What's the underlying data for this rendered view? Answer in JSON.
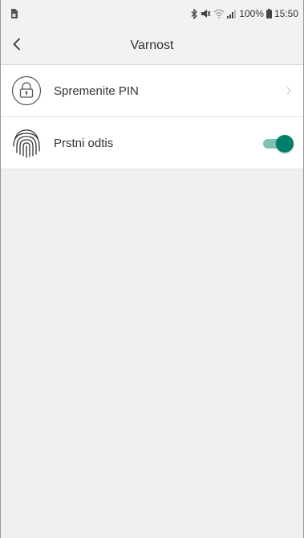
{
  "status_bar": {
    "battery_percent": "100%",
    "time": "15:50",
    "icons": [
      "sim-icon",
      "bluetooth-icon",
      "mute-icon",
      "wifi-icon",
      "signal-icon",
      "battery-icon"
    ]
  },
  "app_bar": {
    "title": "Varnost",
    "back_icon": "back-arrow-icon"
  },
  "settings": [
    {
      "label": "Spremenite PIN",
      "icon": "lock-icon",
      "control": "chevron"
    },
    {
      "label": "Prstni odtis",
      "icon": "fingerprint-icon",
      "control": "toggle",
      "enabled": true
    }
  ],
  "colors": {
    "accent": "#00806a",
    "accent_track": "#7fc2b3",
    "background": "#f0f0f0",
    "list_background": "#ffffff"
  }
}
